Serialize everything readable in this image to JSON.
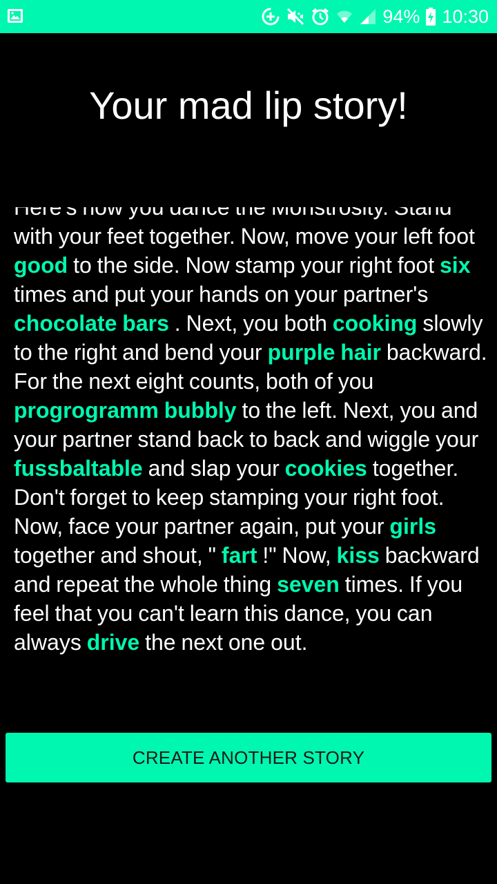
{
  "status_bar": {
    "battery": "94%",
    "time": "10:30",
    "icons": [
      "gallery-icon",
      "data-saver-icon",
      "vibrate-icon",
      "alarm-icon",
      "wifi-icon",
      "signal-icon",
      "battery-charging-icon"
    ]
  },
  "colors": {
    "accent": "#00F7AF",
    "background": "#000000",
    "text": "#ffffff"
  },
  "title": "Your mad lip story!",
  "story": {
    "t0": "Here's how you dance the Monstrosity. Stand with your feet together. Now, move your left foot ",
    "w1": "good",
    "t1": " to the side. Now stamp your right foot ",
    "w2": "six",
    "t2": " times and put your hands on your partner's ",
    "w3": "chocolate bars",
    "t3": " . Next, you both ",
    "w4": "cooking",
    "t4": " slowly to the right and bend your ",
    "w5": "purple hair",
    "t5": " backward. For the next eight counts, both of you ",
    "w6": "progrogramm bubbly",
    "t6": " to the left. Next, you and your partner stand back to back and wiggle your ",
    "w7": "fussbaltable",
    "t7": " and slap your ",
    "w8": "cookies",
    "t8": " together. Don't forget to keep stamping your right foot. Now, face your partner again, put your ",
    "w9": "girls",
    "t9": " together and shout, \" ",
    "w10": "fart",
    "t10": " !\" Now, ",
    "w11": "kiss",
    "t11": " backward and repeat the whole thing ",
    "w12": "seven",
    "t12": " times. If you feel that you can't learn this dance, you can always ",
    "w13": "drive",
    "t13": " the next one out."
  },
  "button": {
    "label": "CREATE ANOTHER STORY"
  }
}
